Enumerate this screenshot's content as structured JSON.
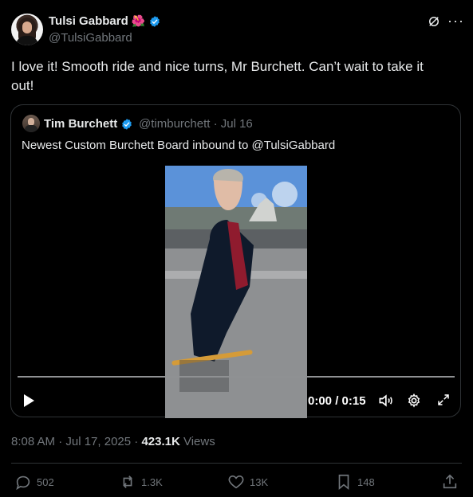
{
  "tweet": {
    "name": "Tulsi Gabbard",
    "handle": "@TulsiGabbard",
    "flower_emoji": "🌺",
    "text_line1": "I love it! Smooth ride and nice turns, Mr Burchett.  Can’t wait to take it",
    "text_line2": "out!",
    "timestamp": "8:08 AM · Jul 17, 2025 · ",
    "views_count": "423.1K",
    "views_label": " Views"
  },
  "quote": {
    "name": "Tim Burchett",
    "meta": "@timburchett · Jul 16",
    "text": "Newest Custom Burchett Board inbound to @TulsiGabbard"
  },
  "video": {
    "time": "0:00 / 0:15",
    "progress": 0
  },
  "actions": {
    "replies": "502",
    "reposts": "1.3K",
    "likes": "13K",
    "bookmarks": "148"
  },
  "colors": {
    "background": "#000000",
    "text": "#e7e9ea",
    "muted": "#71767b",
    "verified": "#1d9bf0"
  }
}
